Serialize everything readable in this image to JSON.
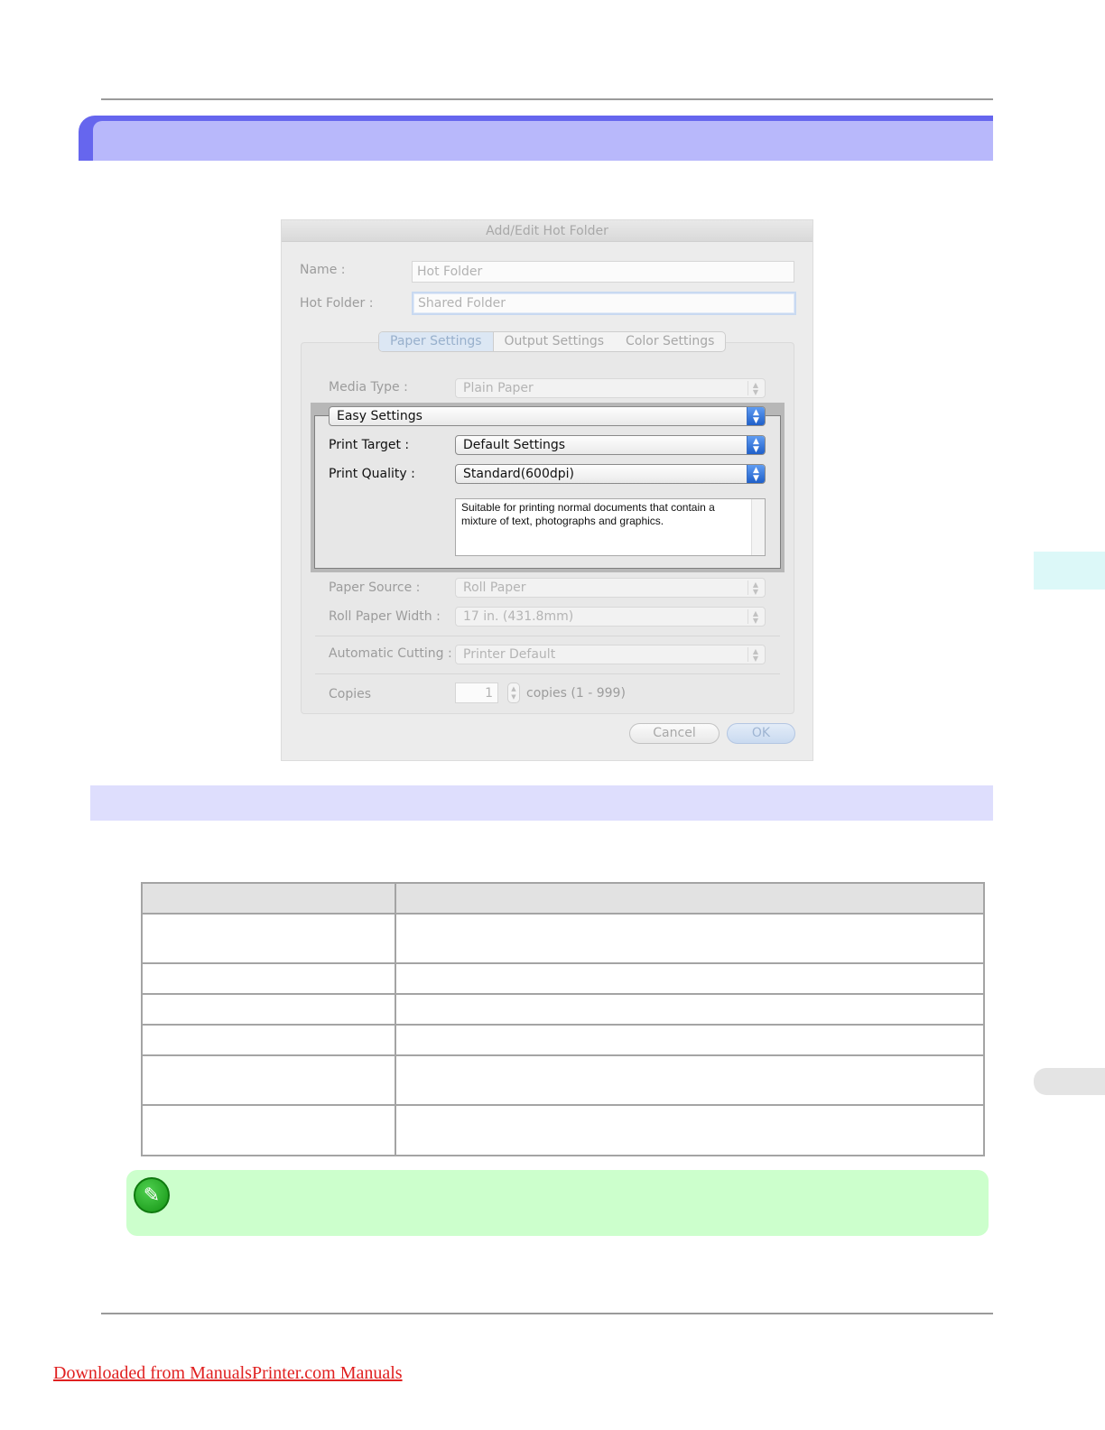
{
  "dialog": {
    "title": "Add/Edit Hot Folder",
    "name_label": "Name :",
    "name_value": "Hot Folder",
    "hot_folder_label": "Hot Folder :",
    "hot_folder_value": "Shared Folder",
    "tabs": [
      "Paper Settings",
      "Output Settings",
      "Color Settings"
    ],
    "media_type_label": "Media Type :",
    "media_type_value": "Plain Paper",
    "easy_settings_value": "Easy Settings",
    "print_target_label": "Print Target :",
    "print_target_value": "Default Settings",
    "print_quality_label": "Print Quality :",
    "print_quality_value": "Standard(600dpi)",
    "description": "Suitable for printing normal documents that contain a mixture of text, photographs and graphics.",
    "paper_source_label": "Paper Source :",
    "paper_source_value": "Roll Paper",
    "roll_width_label": "Roll Paper Width :",
    "roll_width_value": "17 in. (431.8mm)",
    "auto_cut_label": "Automatic Cutting :",
    "auto_cut_value": "Printer Default",
    "copies_label": "Copies",
    "copies_value": "1",
    "copies_range": "copies (1 - 999)",
    "cancel_label": "Cancel",
    "ok_label": "OK"
  },
  "footer": {
    "link_text": "Downloaded from ManualsPrinter.com Manuals"
  },
  "colors": {
    "section_header": "#b8b8fb",
    "section_header_edge": "#6666ee",
    "subsection_header": "#dedefd",
    "note_background": "#ccffcc",
    "link": "#e02020"
  },
  "icons": {
    "note": "pencil-icon"
  }
}
